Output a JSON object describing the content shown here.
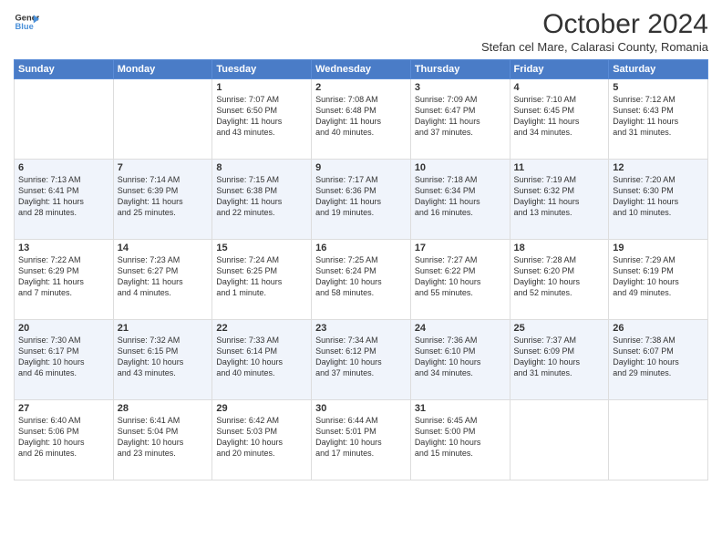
{
  "logo": {
    "line1": "General",
    "line2": "Blue"
  },
  "title": "October 2024",
  "subtitle": "Stefan cel Mare, Calarasi County, Romania",
  "days_header": [
    "Sunday",
    "Monday",
    "Tuesday",
    "Wednesday",
    "Thursday",
    "Friday",
    "Saturday"
  ],
  "weeks": [
    [
      {
        "day": "",
        "text": ""
      },
      {
        "day": "",
        "text": ""
      },
      {
        "day": "1",
        "text": "Sunrise: 7:07 AM\nSunset: 6:50 PM\nDaylight: 11 hours\nand 43 minutes."
      },
      {
        "day": "2",
        "text": "Sunrise: 7:08 AM\nSunset: 6:48 PM\nDaylight: 11 hours\nand 40 minutes."
      },
      {
        "day": "3",
        "text": "Sunrise: 7:09 AM\nSunset: 6:47 PM\nDaylight: 11 hours\nand 37 minutes."
      },
      {
        "day": "4",
        "text": "Sunrise: 7:10 AM\nSunset: 6:45 PM\nDaylight: 11 hours\nand 34 minutes."
      },
      {
        "day": "5",
        "text": "Sunrise: 7:12 AM\nSunset: 6:43 PM\nDaylight: 11 hours\nand 31 minutes."
      }
    ],
    [
      {
        "day": "6",
        "text": "Sunrise: 7:13 AM\nSunset: 6:41 PM\nDaylight: 11 hours\nand 28 minutes."
      },
      {
        "day": "7",
        "text": "Sunrise: 7:14 AM\nSunset: 6:39 PM\nDaylight: 11 hours\nand 25 minutes."
      },
      {
        "day": "8",
        "text": "Sunrise: 7:15 AM\nSunset: 6:38 PM\nDaylight: 11 hours\nand 22 minutes."
      },
      {
        "day": "9",
        "text": "Sunrise: 7:17 AM\nSunset: 6:36 PM\nDaylight: 11 hours\nand 19 minutes."
      },
      {
        "day": "10",
        "text": "Sunrise: 7:18 AM\nSunset: 6:34 PM\nDaylight: 11 hours\nand 16 minutes."
      },
      {
        "day": "11",
        "text": "Sunrise: 7:19 AM\nSunset: 6:32 PM\nDaylight: 11 hours\nand 13 minutes."
      },
      {
        "day": "12",
        "text": "Sunrise: 7:20 AM\nSunset: 6:30 PM\nDaylight: 11 hours\nand 10 minutes."
      }
    ],
    [
      {
        "day": "13",
        "text": "Sunrise: 7:22 AM\nSunset: 6:29 PM\nDaylight: 11 hours\nand 7 minutes."
      },
      {
        "day": "14",
        "text": "Sunrise: 7:23 AM\nSunset: 6:27 PM\nDaylight: 11 hours\nand 4 minutes."
      },
      {
        "day": "15",
        "text": "Sunrise: 7:24 AM\nSunset: 6:25 PM\nDaylight: 11 hours\nand 1 minute."
      },
      {
        "day": "16",
        "text": "Sunrise: 7:25 AM\nSunset: 6:24 PM\nDaylight: 10 hours\nand 58 minutes."
      },
      {
        "day": "17",
        "text": "Sunrise: 7:27 AM\nSunset: 6:22 PM\nDaylight: 10 hours\nand 55 minutes."
      },
      {
        "day": "18",
        "text": "Sunrise: 7:28 AM\nSunset: 6:20 PM\nDaylight: 10 hours\nand 52 minutes."
      },
      {
        "day": "19",
        "text": "Sunrise: 7:29 AM\nSunset: 6:19 PM\nDaylight: 10 hours\nand 49 minutes."
      }
    ],
    [
      {
        "day": "20",
        "text": "Sunrise: 7:30 AM\nSunset: 6:17 PM\nDaylight: 10 hours\nand 46 minutes."
      },
      {
        "day": "21",
        "text": "Sunrise: 7:32 AM\nSunset: 6:15 PM\nDaylight: 10 hours\nand 43 minutes."
      },
      {
        "day": "22",
        "text": "Sunrise: 7:33 AM\nSunset: 6:14 PM\nDaylight: 10 hours\nand 40 minutes."
      },
      {
        "day": "23",
        "text": "Sunrise: 7:34 AM\nSunset: 6:12 PM\nDaylight: 10 hours\nand 37 minutes."
      },
      {
        "day": "24",
        "text": "Sunrise: 7:36 AM\nSunset: 6:10 PM\nDaylight: 10 hours\nand 34 minutes."
      },
      {
        "day": "25",
        "text": "Sunrise: 7:37 AM\nSunset: 6:09 PM\nDaylight: 10 hours\nand 31 minutes."
      },
      {
        "day": "26",
        "text": "Sunrise: 7:38 AM\nSunset: 6:07 PM\nDaylight: 10 hours\nand 29 minutes."
      }
    ],
    [
      {
        "day": "27",
        "text": "Sunrise: 6:40 AM\nSunset: 5:06 PM\nDaylight: 10 hours\nand 26 minutes."
      },
      {
        "day": "28",
        "text": "Sunrise: 6:41 AM\nSunset: 5:04 PM\nDaylight: 10 hours\nand 23 minutes."
      },
      {
        "day": "29",
        "text": "Sunrise: 6:42 AM\nSunset: 5:03 PM\nDaylight: 10 hours\nand 20 minutes."
      },
      {
        "day": "30",
        "text": "Sunrise: 6:44 AM\nSunset: 5:01 PM\nDaylight: 10 hours\nand 17 minutes."
      },
      {
        "day": "31",
        "text": "Sunrise: 6:45 AM\nSunset: 5:00 PM\nDaylight: 10 hours\nand 15 minutes."
      },
      {
        "day": "",
        "text": ""
      },
      {
        "day": "",
        "text": ""
      }
    ]
  ]
}
